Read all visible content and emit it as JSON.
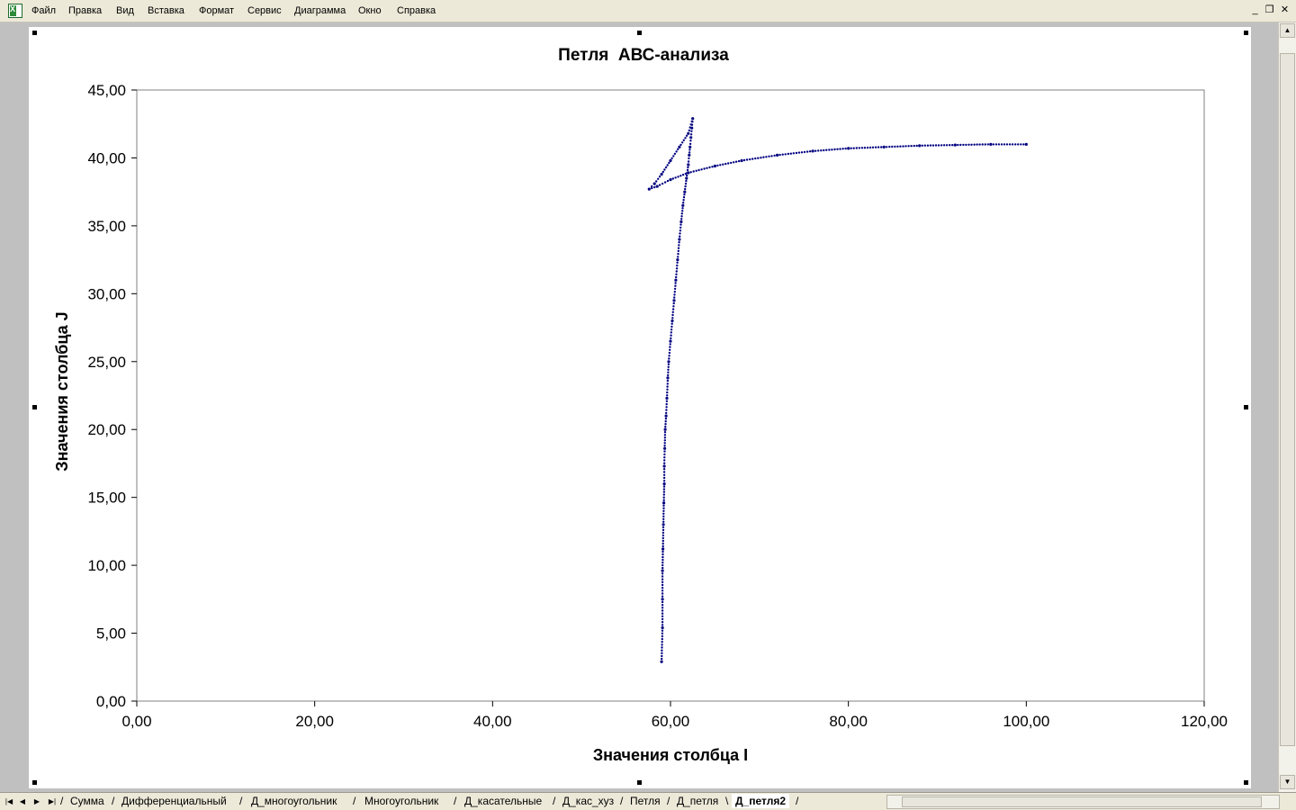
{
  "menu": {
    "items": [
      "Файл",
      "Правка",
      "Вид",
      "Вставка",
      "Формат",
      "Сервис",
      "Диаграмма",
      "Окно",
      "Справка"
    ]
  },
  "window_controls": {
    "minimize": "_",
    "restore": "❐",
    "close": "✕"
  },
  "sheet_tabs": {
    "items": [
      "Сумма",
      "Дифференциальный",
      "Д_многоугольник",
      "Многоугольник",
      "Д_касательные",
      "Д_кас_хуз",
      "Петля",
      "Д_петля",
      "Д_петля2"
    ],
    "active": "Д_петля2"
  },
  "colors": {
    "series": "#000080",
    "axis": "#000000",
    "frame": "#ffffff"
  },
  "chart_data": {
    "type": "scatter",
    "title": "Петля  АВС-анализа",
    "xlabel": "Значения столбца I",
    "ylabel": "Значения столбца J",
    "xlim": [
      0,
      120
    ],
    "ylim": [
      0,
      45
    ],
    "x_ticks": [
      "0,00",
      "20,00",
      "40,00",
      "60,00",
      "80,00",
      "100,00",
      "120,00"
    ],
    "y_ticks": [
      "0,00",
      "5,00",
      "10,00",
      "15,00",
      "20,00",
      "25,00",
      "30,00",
      "35,00",
      "40,00",
      "45,00"
    ],
    "grid": false,
    "legend": "none",
    "series": [
      {
        "markers": true,
        "points": [
          [
            59.0,
            2.9
          ],
          [
            59.1,
            5.4
          ],
          [
            59.1,
            7.5
          ],
          [
            59.1,
            9.6
          ],
          [
            59.15,
            11.2
          ],
          [
            59.2,
            13.0
          ],
          [
            59.25,
            14.6
          ],
          [
            59.3,
            16.0
          ],
          [
            59.3,
            17.3
          ],
          [
            59.35,
            18.6
          ],
          [
            59.4,
            20.0
          ],
          [
            59.5,
            21.0
          ],
          [
            59.6,
            22.3
          ],
          [
            59.7,
            23.8
          ],
          [
            59.8,
            25.0
          ],
          [
            60.0,
            26.5
          ],
          [
            60.2,
            28.0
          ],
          [
            60.4,
            29.5
          ],
          [
            60.6,
            31.0
          ],
          [
            60.8,
            32.5
          ],
          [
            61.0,
            34.0
          ],
          [
            61.2,
            35.3
          ],
          [
            61.4,
            36.5
          ],
          [
            61.6,
            37.5
          ],
          [
            61.8,
            38.5
          ],
          [
            62.0,
            39.5
          ],
          [
            62.1,
            40.2
          ],
          [
            62.2,
            40.8
          ],
          [
            62.3,
            41.5
          ],
          [
            62.4,
            42.2
          ],
          [
            62.5,
            42.9
          ],
          [
            62.0,
            41.8
          ],
          [
            61.0,
            40.8
          ],
          [
            60.0,
            39.8
          ],
          [
            59.0,
            38.8
          ],
          [
            58.2,
            38.1
          ],
          [
            57.6,
            37.7
          ],
          [
            58.5,
            37.9
          ],
          [
            60.0,
            38.4
          ],
          [
            62.0,
            38.9
          ],
          [
            65.0,
            39.4
          ],
          [
            68.0,
            39.8
          ],
          [
            72.0,
            40.2
          ],
          [
            76.0,
            40.5
          ],
          [
            80.0,
            40.7
          ],
          [
            84.0,
            40.8
          ],
          [
            88.0,
            40.9
          ],
          [
            92.0,
            40.95
          ],
          [
            96.0,
            41.0
          ],
          [
            100.0,
            41.0
          ]
        ]
      }
    ]
  }
}
